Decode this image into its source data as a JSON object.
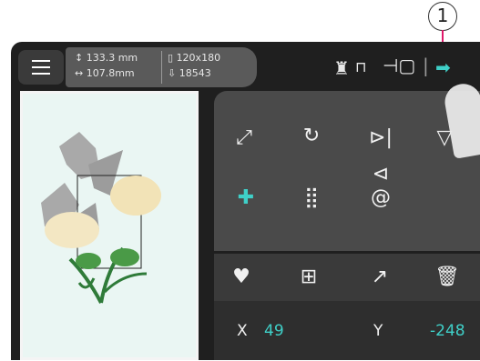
{
  "callout": {
    "number": "1"
  },
  "header": {
    "height_line": "133.3 mm",
    "width_line": "107.8mm",
    "hoop_line": "120x180",
    "stitches_line": "18543"
  },
  "coords": {
    "x_label": "X",
    "x_value": "49",
    "y_label": "Y",
    "y_value": "-248"
  }
}
